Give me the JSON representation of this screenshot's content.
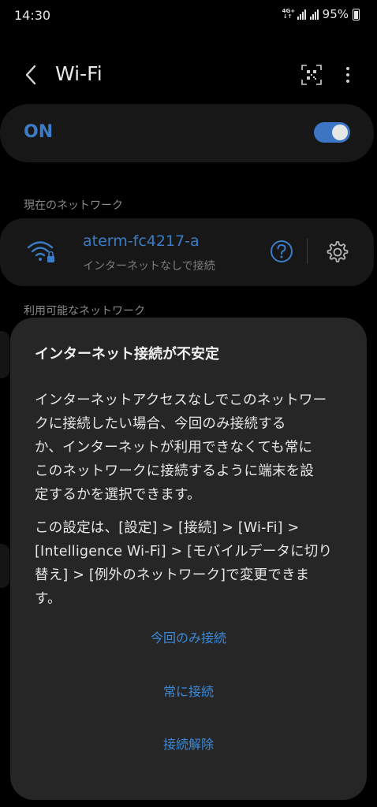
{
  "status_bar": {
    "time": "14:30",
    "network_type": "4G+",
    "battery": "95%"
  },
  "header": {
    "title": "Wi-Fi",
    "back_icon": "back-arrow-icon",
    "qr_icon": "qr-code-scan-icon",
    "more_icon": "more-vertical-icon"
  },
  "master_toggle": {
    "label": "ON",
    "state": true
  },
  "current_network": {
    "section_label": "現在のネットワーク",
    "name": "aterm-fc4217-a",
    "status": "インターネットなしで接続",
    "icons": [
      "wifi-lock-icon",
      "help-icon",
      "settings-gear-icon"
    ]
  },
  "available_networks": {
    "section_label": "利用可能なネットワーク"
  },
  "dialog": {
    "title": "インターネット接続が不安定",
    "body_lines_1": [
      "インターネットアクセスなしでこのネットワー",
      "クに接続したい場合、今回のみ接続する",
      "か、インターネットが利用できなくても常に",
      "このネットワークに接続するように端末を設",
      "定するかを選択できます。"
    ],
    "body_lines_2": [
      "この設定は、[設定] > [接続] > [Wi-Fi] >",
      "[Intelligence Wi-Fi] > [モバイルデータに切り",
      "替え] > [例外のネットワーク]で変更できま",
      "す。"
    ],
    "buttons": {
      "once": "今回のみ接続",
      "always": "常に接続",
      "disconnect": "接続解除"
    }
  },
  "colors": {
    "accent": "#3b7cc7",
    "background": "#000000",
    "card": "#171717",
    "dialog": "#262626"
  }
}
